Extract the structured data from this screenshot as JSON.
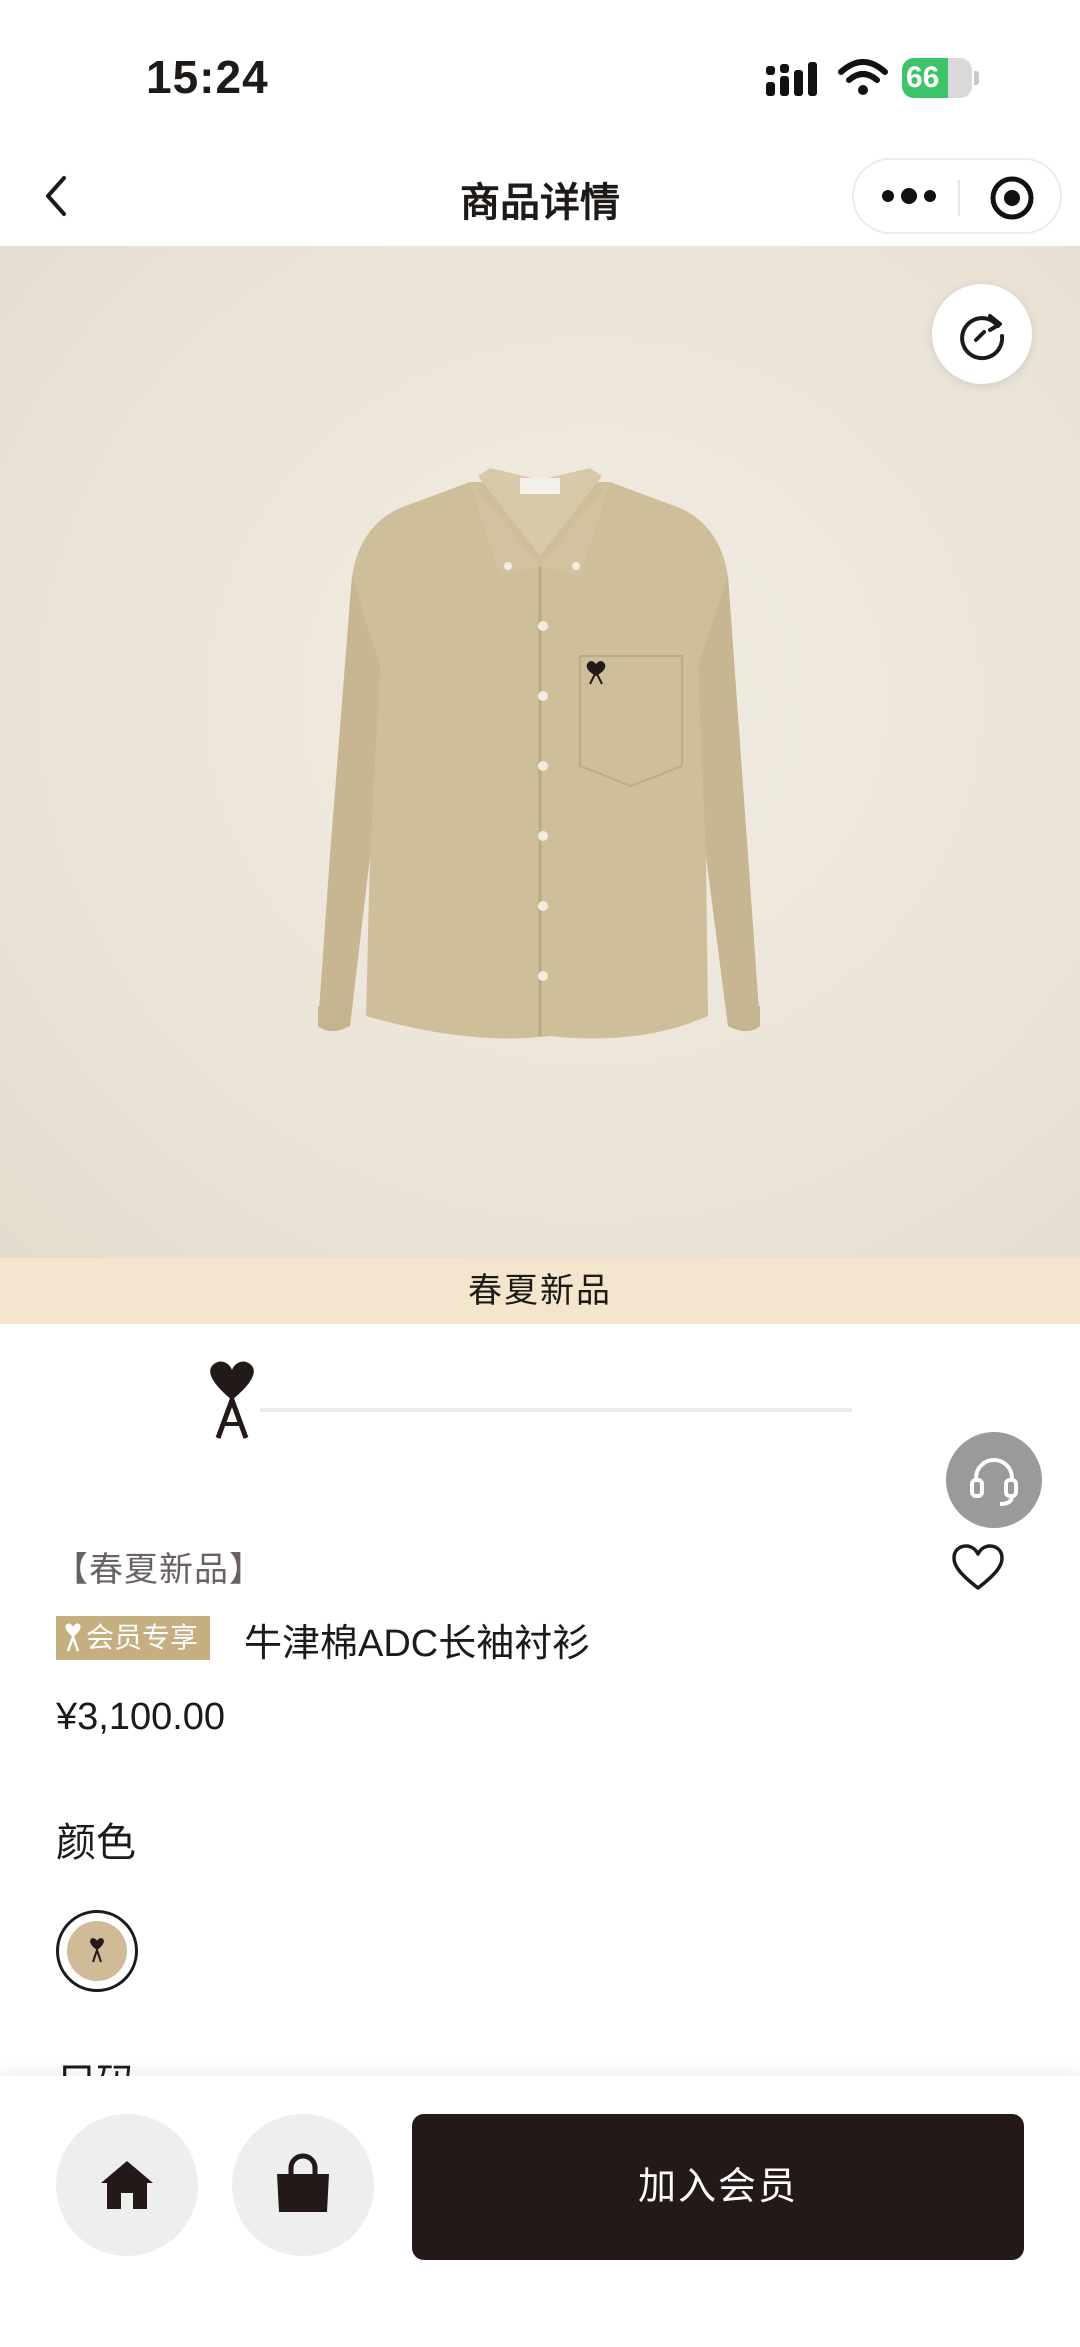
{
  "status_bar": {
    "time": "15:24",
    "battery_level": "66",
    "battery_fraction": 0.66
  },
  "nav": {
    "title": "商品详情",
    "back_icon": "chevron-left-icon",
    "more_icon": "more-dots-icon",
    "close_icon": "target-close-icon"
  },
  "hero": {
    "refresh_icon": "refresh-icon",
    "banner_text": "春夏新品"
  },
  "product": {
    "tag": "【春夏新品】",
    "member_badge": "会员专享",
    "name": "牛津棉ADC长袖衬衫",
    "price": "¥3,100.00"
  },
  "options": {
    "color_label": "颜色",
    "size_label_peek": "尺码",
    "swatch_color": "#cfbb98"
  },
  "actions": {
    "service_icon": "headset-icon",
    "favorite_icon": "heart-icon"
  },
  "bottom_bar": {
    "home_icon": "home-icon",
    "bag_icon": "shopping-bag-icon",
    "join_label": "加入会员"
  },
  "colors": {
    "accent": "#231918",
    "banner": "#f4e6cc",
    "badge": "#c5ae80"
  }
}
